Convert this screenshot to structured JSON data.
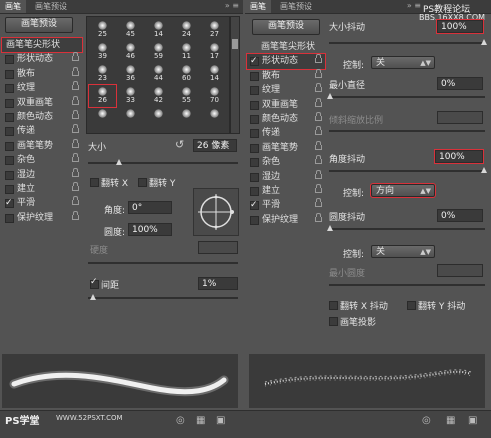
{
  "left_panel": {
    "tabs": [
      "画笔",
      "画笔预设"
    ],
    "preset_button": "画笔预设",
    "categories": [
      {
        "label": "画笔笔尖形状",
        "checkbox": false,
        "lock": false,
        "highlighted": true
      },
      {
        "label": "形状动态",
        "checkbox": true,
        "checked": false,
        "lock": true
      },
      {
        "label": "散布",
        "checkbox": true,
        "checked": false,
        "lock": true
      },
      {
        "label": "纹理",
        "checkbox": true,
        "checked": false,
        "lock": true
      },
      {
        "label": "双重画笔",
        "checkbox": true,
        "checked": false,
        "lock": true
      },
      {
        "label": "颜色动态",
        "checkbox": true,
        "checked": false,
        "lock": true
      },
      {
        "label": "传递",
        "checkbox": true,
        "checked": false,
        "lock": true
      },
      {
        "label": "画笔笔势",
        "checkbox": true,
        "checked": false,
        "lock": true
      },
      {
        "label": "杂色",
        "checkbox": true,
        "checked": false,
        "lock": true
      },
      {
        "label": "湿边",
        "checkbox": true,
        "checked": false,
        "lock": true
      },
      {
        "label": "建立",
        "checkbox": true,
        "checked": false,
        "lock": true
      },
      {
        "label": "平滑",
        "checkbox": true,
        "checked": true,
        "lock": true
      },
      {
        "label": "保护纹理",
        "checkbox": true,
        "checked": false,
        "lock": true
      }
    ],
    "brush_sizes": [
      "25",
      "45",
      "14",
      "24",
      "27",
      "39",
      "46",
      "59",
      "11",
      "17",
      "23",
      "36",
      "44",
      "60",
      "14",
      "26",
      "33",
      "42",
      "55",
      "70",
      "",
      "",
      "",
      "",
      ""
    ],
    "selected_brush_size": "26",
    "size_label": "大小",
    "size_value": "26 像素",
    "flip_x": "翻转 X",
    "flip_y": "翻转 Y",
    "angle_label": "角度:",
    "angle_value": "0°",
    "roundness_label": "圆度:",
    "roundness_value": "100%",
    "hardness_label": "硬度",
    "spacing_label": "间距",
    "spacing_checked": true,
    "spacing_value": "1%",
    "watermark": "PS学堂",
    "watermark_url": "WWW.52PSXT.COM"
  },
  "right_panel": {
    "tabs": [
      "画笔",
      "画笔预设"
    ],
    "preset_button": "画笔预设",
    "watermark": "PS教程论坛",
    "watermark_url": "BBS.16XX8.COM",
    "categories": [
      {
        "label": "画笔笔尖形状",
        "checkbox": false,
        "lock": false
      },
      {
        "label": "形状动态",
        "checkbox": true,
        "checked": true,
        "lock": true,
        "highlighted": true
      },
      {
        "label": "散布",
        "checkbox": true,
        "checked": false,
        "lock": true
      },
      {
        "label": "纹理",
        "checkbox": true,
        "checked": false,
        "lock": true
      },
      {
        "label": "双重画笔",
        "checkbox": true,
        "checked": false,
        "lock": true
      },
      {
        "label": "颜色动态",
        "checkbox": true,
        "checked": false,
        "lock": true
      },
      {
        "label": "传递",
        "checkbox": true,
        "checked": false,
        "lock": true
      },
      {
        "label": "画笔笔势",
        "checkbox": true,
        "checked": false,
        "lock": true
      },
      {
        "label": "杂色",
        "checkbox": true,
        "checked": false,
        "lock": true
      },
      {
        "label": "湿边",
        "checkbox": true,
        "checked": false,
        "lock": true
      },
      {
        "label": "建立",
        "checkbox": true,
        "checked": false,
        "lock": true
      },
      {
        "label": "平滑",
        "checkbox": true,
        "checked": true,
        "lock": true
      },
      {
        "label": "保护纹理",
        "checkbox": true,
        "checked": false,
        "lock": true
      }
    ],
    "size_jitter_label": "大小抖动",
    "size_jitter_value": "100%",
    "control_label": "控制:",
    "control1_value": "关",
    "min_diameter_label": "最小直径",
    "min_diameter_value": "0%",
    "tilt_scale_label": "倾斜缩放比例",
    "angle_jitter_label": "角度抖动",
    "angle_jitter_value": "100%",
    "control2_value": "方向",
    "roundness_jitter_label": "圆度抖动",
    "roundness_jitter_value": "0%",
    "control3_value": "关",
    "min_roundness_label": "最小圆度",
    "flip_x_jitter": "翻转 X 抖动",
    "flip_y_jitter": "翻转 Y 抖动",
    "brush_projection": "画笔投影"
  },
  "colors": {
    "highlight": "#d9313a",
    "panel": "#535353",
    "field": "#3a3a3a"
  }
}
